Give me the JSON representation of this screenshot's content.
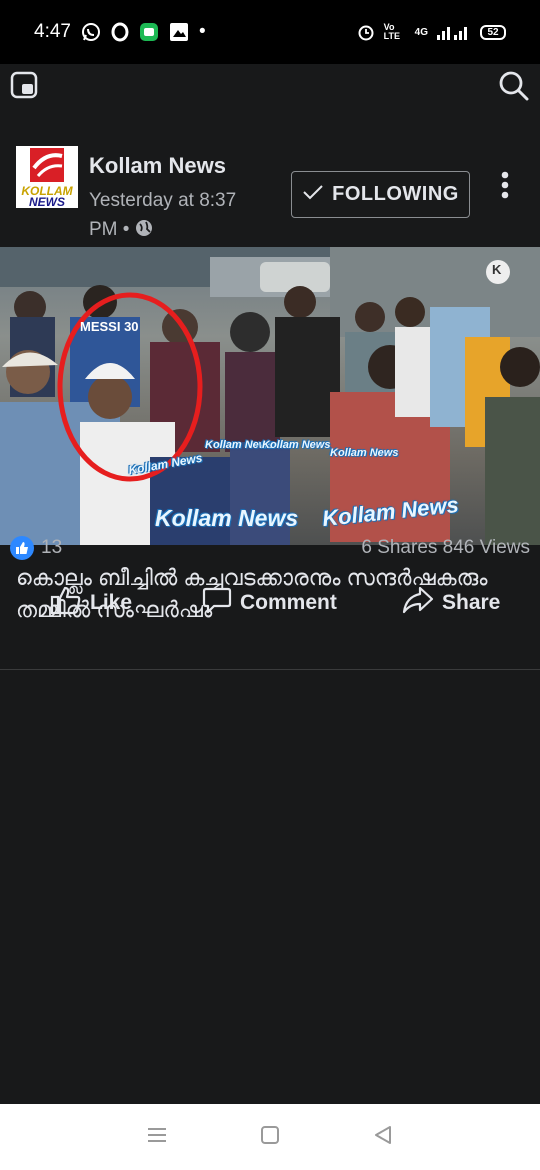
{
  "status_bar": {
    "time": "4:47",
    "left_icons": [
      "whatsapp-icon",
      "opera-icon",
      "messages-icon",
      "gallery-icon"
    ],
    "dot": "•",
    "lte_label": "Vo LTE",
    "network": "4G",
    "battery": "52"
  },
  "post": {
    "page_name": "Kollam News",
    "meta": "Yesterday at 8:37 PM •",
    "follow_label": "FOLLOWING",
    "logo": {
      "line1": "KOLLAM",
      "line2": "NEWS"
    },
    "video": {
      "player_badge": "K",
      "watermarks": [
        "Kollam News",
        "Kollam News",
        "Kollam News",
        "Kollam News",
        "Kollam News",
        "Kollam News"
      ],
      "jersey": "MESSI 30"
    },
    "caption": "കൊല്ലം ബീച്ചിൽ കച്ചവടക്കാരനും സന്ദർഷകരും തമ്മിൽ സംഘർഷം",
    "reactions_count": "13",
    "shares_views": "6 Shares 846 Views",
    "actions": {
      "like": "Like",
      "comment": "Comment",
      "share": "Share"
    }
  },
  "colors": {
    "background": "#18191a",
    "accent": "#2d88ff",
    "logo_red": "#d91f26"
  }
}
